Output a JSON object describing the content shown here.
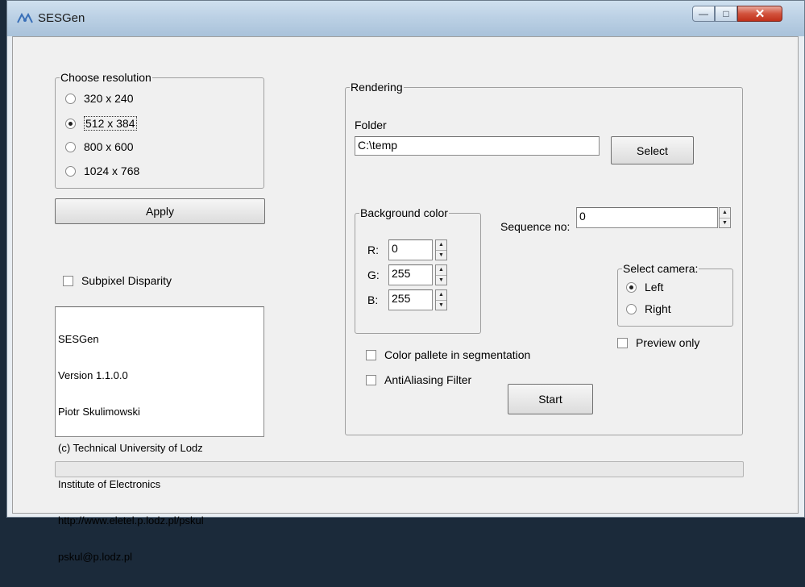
{
  "window": {
    "title": "SESGen"
  },
  "resolution": {
    "legend": "Choose resolution",
    "options": [
      "320 x 240",
      "512 x 384",
      "800 x 600",
      "1024 x 768"
    ],
    "selected": "512 x 384",
    "apply_label": "Apply"
  },
  "subpixel": {
    "label": "Subpixel Disparity",
    "checked": false
  },
  "about": {
    "lines": [
      "SESGen",
      "Version 1.1.0.0",
      "Piotr Skulimowski",
      "(c) Technical University of Lodz",
      "Institute of Electronics",
      "http://www.eletel.p.lodz.pl/pskul",
      "pskul@p.lodz.pl"
    ]
  },
  "rendering": {
    "legend": "Rendering",
    "folder_label": "Folder",
    "folder_value": "C:\\temp",
    "select_label": "Select",
    "background": {
      "legend": "Background color",
      "r_label": "R:",
      "r_value": "0",
      "g_label": "G:",
      "g_value": "255",
      "b_label": "B:",
      "b_value": "255"
    },
    "sequence_label": "Sequence no:",
    "sequence_value": "0",
    "camera": {
      "legend": "Select camera:",
      "options": [
        "Left",
        "Right"
      ],
      "selected": "Left"
    },
    "preview_label": "Preview only",
    "color_pallete_label": "Color pallete in segmentation",
    "antialias_label": "AntiAliasing Filter",
    "start_label": "Start"
  },
  "progress": {
    "value": 0
  },
  "colors": {
    "titlebar": "#bcd1e5",
    "close": "#c0301a",
    "face": "#f0f0f0"
  }
}
